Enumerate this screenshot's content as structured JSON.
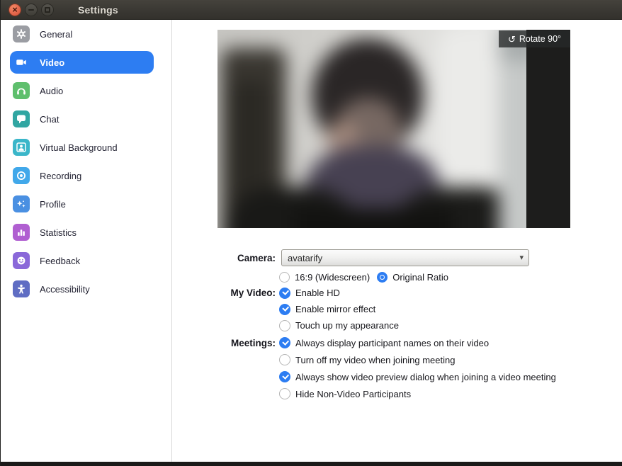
{
  "window": {
    "title": "Settings"
  },
  "sidebar": {
    "items": [
      {
        "label": "General",
        "icon": "gear-icon",
        "color": "#9b9da3",
        "selected": false
      },
      {
        "label": "Video",
        "icon": "video-camera-icon",
        "color": "#2d7df2",
        "selected": true
      },
      {
        "label": "Audio",
        "icon": "headset-icon",
        "color": "#5fbf6d",
        "selected": false
      },
      {
        "label": "Chat",
        "icon": "chat-bubble-icon",
        "color": "#31a6a2",
        "selected": false
      },
      {
        "label": "Virtual Background",
        "icon": "virtual-background-icon",
        "color": "#3ab6c9",
        "selected": false
      },
      {
        "label": "Recording",
        "icon": "record-icon",
        "color": "#41a8ea",
        "selected": false
      },
      {
        "label": "Profile",
        "icon": "sparkles-icon",
        "color": "#4a90e2",
        "selected": false
      },
      {
        "label": "Statistics",
        "icon": "bar-chart-icon",
        "color": "#b05fd1",
        "selected": false
      },
      {
        "label": "Feedback",
        "icon": "smiley-icon",
        "color": "#8a68d9",
        "selected": false
      },
      {
        "label": "Accessibility",
        "icon": "accessibility-icon",
        "color": "#5f6dc3",
        "selected": false
      }
    ]
  },
  "video_preview": {
    "rotate_button_label": "Rotate 90°",
    "rotate_icon": "rotate-ccw-icon"
  },
  "camera": {
    "label": "Camera:",
    "value": "avatarify"
  },
  "aspect": {
    "options": [
      {
        "label": "16:9 (Widescreen)",
        "selected": false
      },
      {
        "label": "Original Ratio",
        "selected": true
      }
    ]
  },
  "my_video": {
    "label": "My Video:",
    "options": [
      {
        "label": "Enable HD",
        "checked": true
      },
      {
        "label": "Enable mirror effect",
        "checked": true
      },
      {
        "label": "Touch up my appearance",
        "checked": false
      }
    ]
  },
  "meetings": {
    "label": "Meetings:",
    "options": [
      {
        "label": "Always display participant names on their video",
        "checked": true
      },
      {
        "label": "Turn off my video when joining meeting",
        "checked": false
      },
      {
        "label": "Always show video preview dialog when joining a video meeting",
        "checked": true
      },
      {
        "label": "Hide Non-Video Participants",
        "checked": false
      }
    ]
  },
  "colors": {
    "accent_blue": "#2d7df2",
    "titlebar_bg": "#3a3833",
    "close_button": "#e2644a",
    "video_letterbox": "#1d1d1c"
  }
}
